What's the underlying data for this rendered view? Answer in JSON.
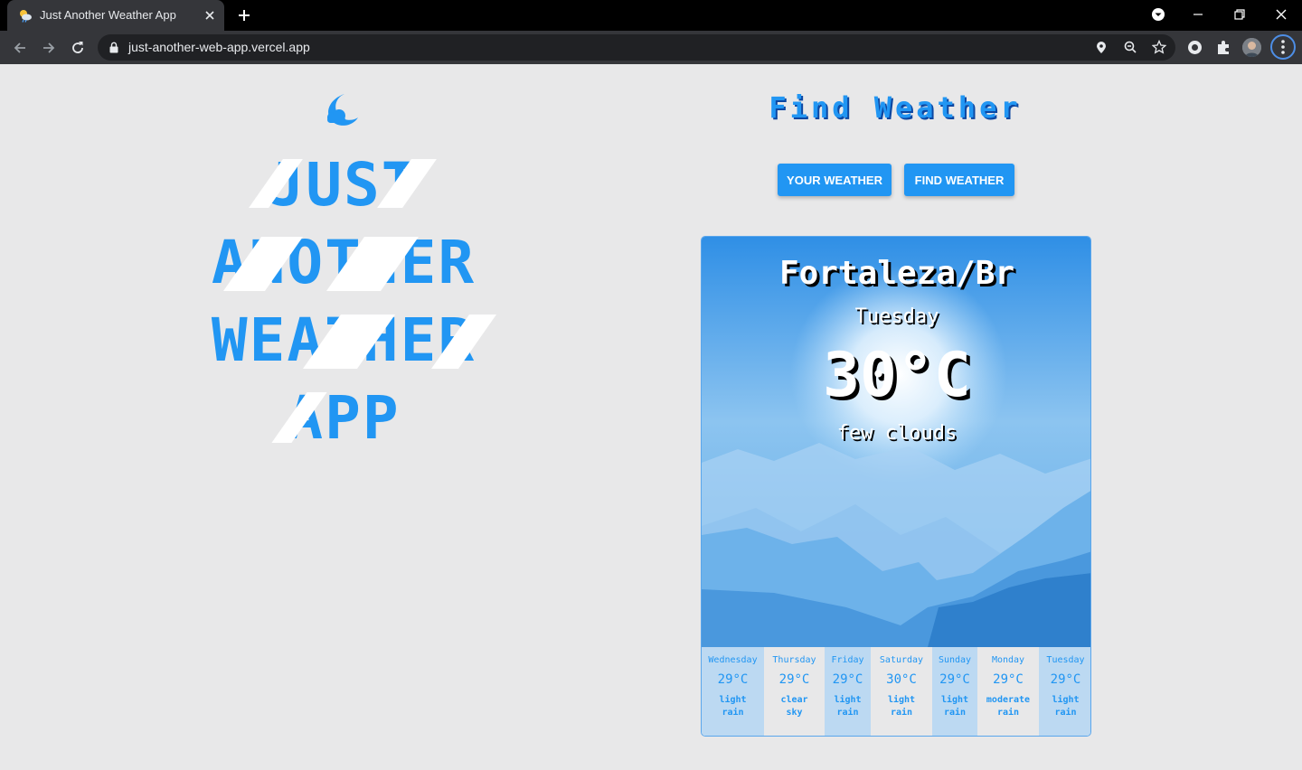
{
  "browser": {
    "tab_title": "Just Another Weather App",
    "url": "just-another-web-app.vercel.app"
  },
  "logo": {
    "icon": "moon-cloud-icon",
    "title_lines": [
      "JUST",
      "ANOTHER",
      "WEATHER",
      "APP"
    ]
  },
  "finder": {
    "heading": "Find Weather",
    "your_weather_label": "YOUR WEATHER",
    "find_weather_label": "FIND WEATHER"
  },
  "current": {
    "city": "Fortaleza/Br",
    "day": "Tuesday",
    "temp": "30°C",
    "description": "few clouds"
  },
  "forecast": [
    {
      "day": "Wednesday",
      "temp": "29°C",
      "desc_1": "light",
      "desc_2": "rain"
    },
    {
      "day": "Thursday",
      "temp": "29°C",
      "desc_1": "clear",
      "desc_2": "sky"
    },
    {
      "day": "Friday",
      "temp": "29°C",
      "desc_1": "light",
      "desc_2": "rain"
    },
    {
      "day": "Saturday",
      "temp": "30°C",
      "desc_1": "light",
      "desc_2": "rain"
    },
    {
      "day": "Sunday",
      "temp": "29°C",
      "desc_1": "light",
      "desc_2": "rain"
    },
    {
      "day": "Monday",
      "temp": "29°C",
      "desc_1": "moderate",
      "desc_2": "rain"
    },
    {
      "day": "Tuesday",
      "temp": "29°C",
      "desc_1": "light",
      "desc_2": "rain"
    }
  ],
  "colors": {
    "accent": "#2196f3",
    "page_bg": "#e8e8e9",
    "forecast_alt_bg": "#bcd9f2"
  }
}
